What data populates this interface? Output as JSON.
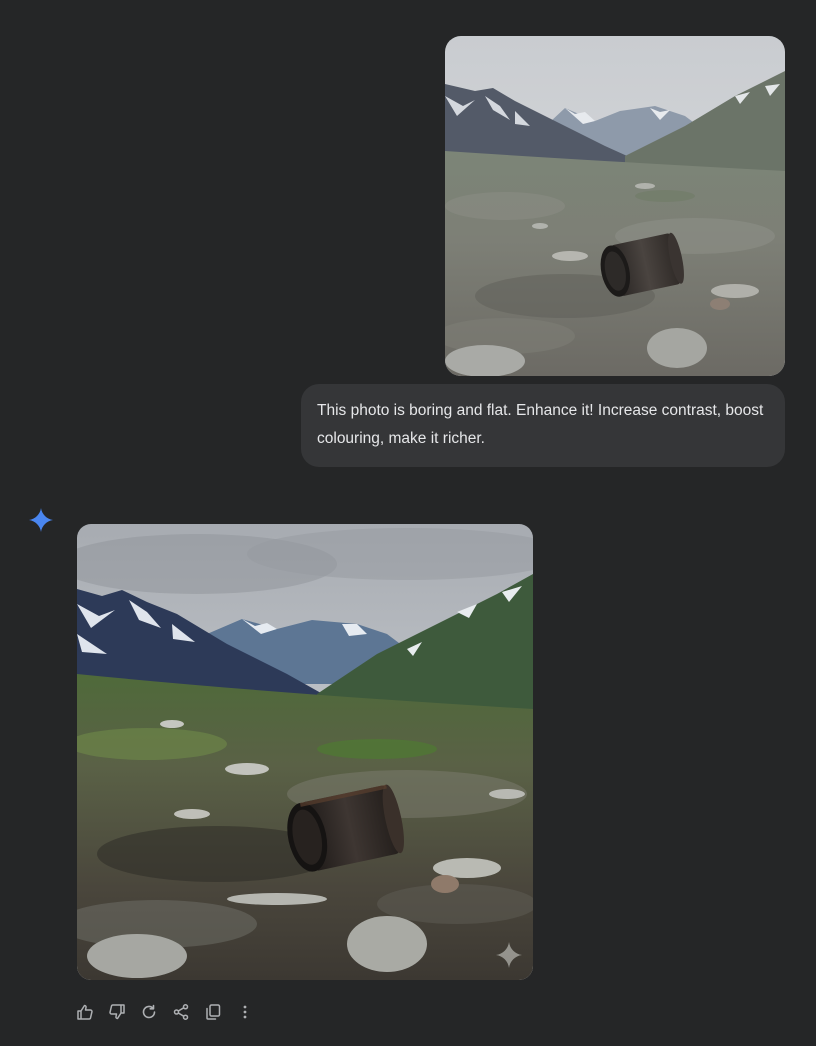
{
  "conversation": {
    "user_message": {
      "text": "This photo is boring and flat. Enhance it! Increase contrast, boost colouring, make it richer."
    },
    "assistant_message": {
      "action_icons": [
        "thumbs-up-icon",
        "thumbs-down-icon",
        "regenerate-icon",
        "share-icon",
        "copy-icon",
        "more-icon"
      ]
    }
  },
  "colors": {
    "background": "#252627",
    "bubble": "#353638",
    "accent_spark": "#4a86f0"
  }
}
